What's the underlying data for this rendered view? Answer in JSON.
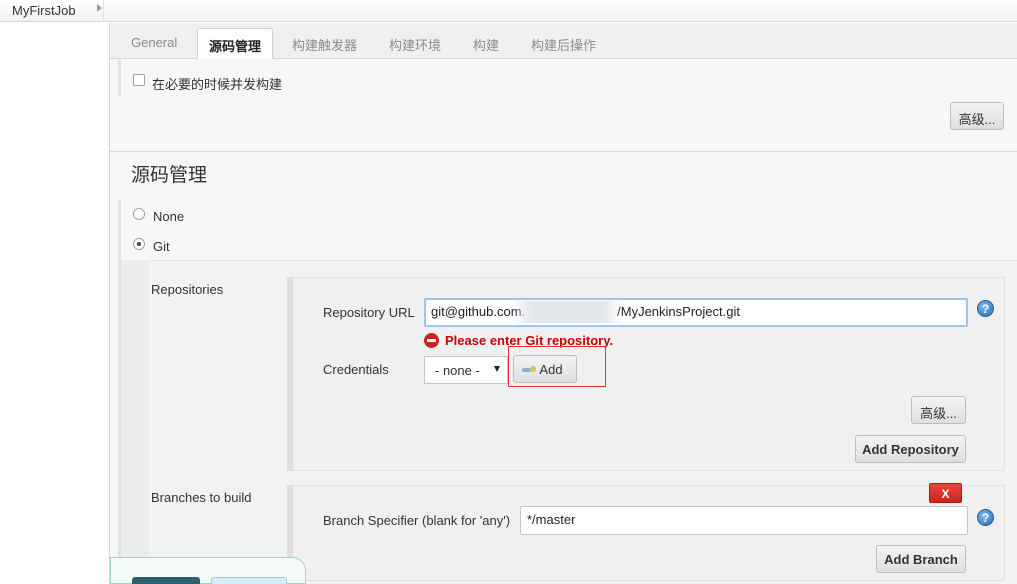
{
  "breadcrumb": {
    "job_name": "MyFirstJob"
  },
  "tabs": [
    {
      "label": "General"
    },
    {
      "label": "源码管理"
    },
    {
      "label": "构建触发器"
    },
    {
      "label": "构建环境"
    },
    {
      "label": "构建"
    },
    {
      "label": "构建后操作"
    }
  ],
  "general_section": {
    "concurrent_build_label": "在必要的时候并发构建",
    "advanced_button": "高级..."
  },
  "scm_section": {
    "title": "源码管理",
    "options": [
      {
        "label": "None",
        "selected": false
      },
      {
        "label": "Git",
        "selected": true
      }
    ],
    "repositories_label": "Repositories",
    "repository_url_label": "Repository URL",
    "repository_url_prefix": "git@github.com.",
    "repository_url_suffix": "/MyJenkinsProject.git",
    "repository_error": "Please enter Git repository.",
    "credentials_label": "Credentials",
    "credentials_value": "- none -",
    "add_credentials_button": "Add",
    "advanced_button": "高级...",
    "add_repository_button": "Add Repository",
    "branches_label": "Branches to build",
    "delete_button": "X",
    "branch_specifier_label": "Branch Specifier (blank for 'any')",
    "branch_specifier_value": "*/master",
    "add_branch_button": "Add Branch"
  },
  "help_icon_glyph": "?",
  "colors": {
    "error": "#cc0000",
    "delete_button": "#d9342b",
    "highlight_box": "#dd3333",
    "focus_border": "#9ec5e8"
  }
}
